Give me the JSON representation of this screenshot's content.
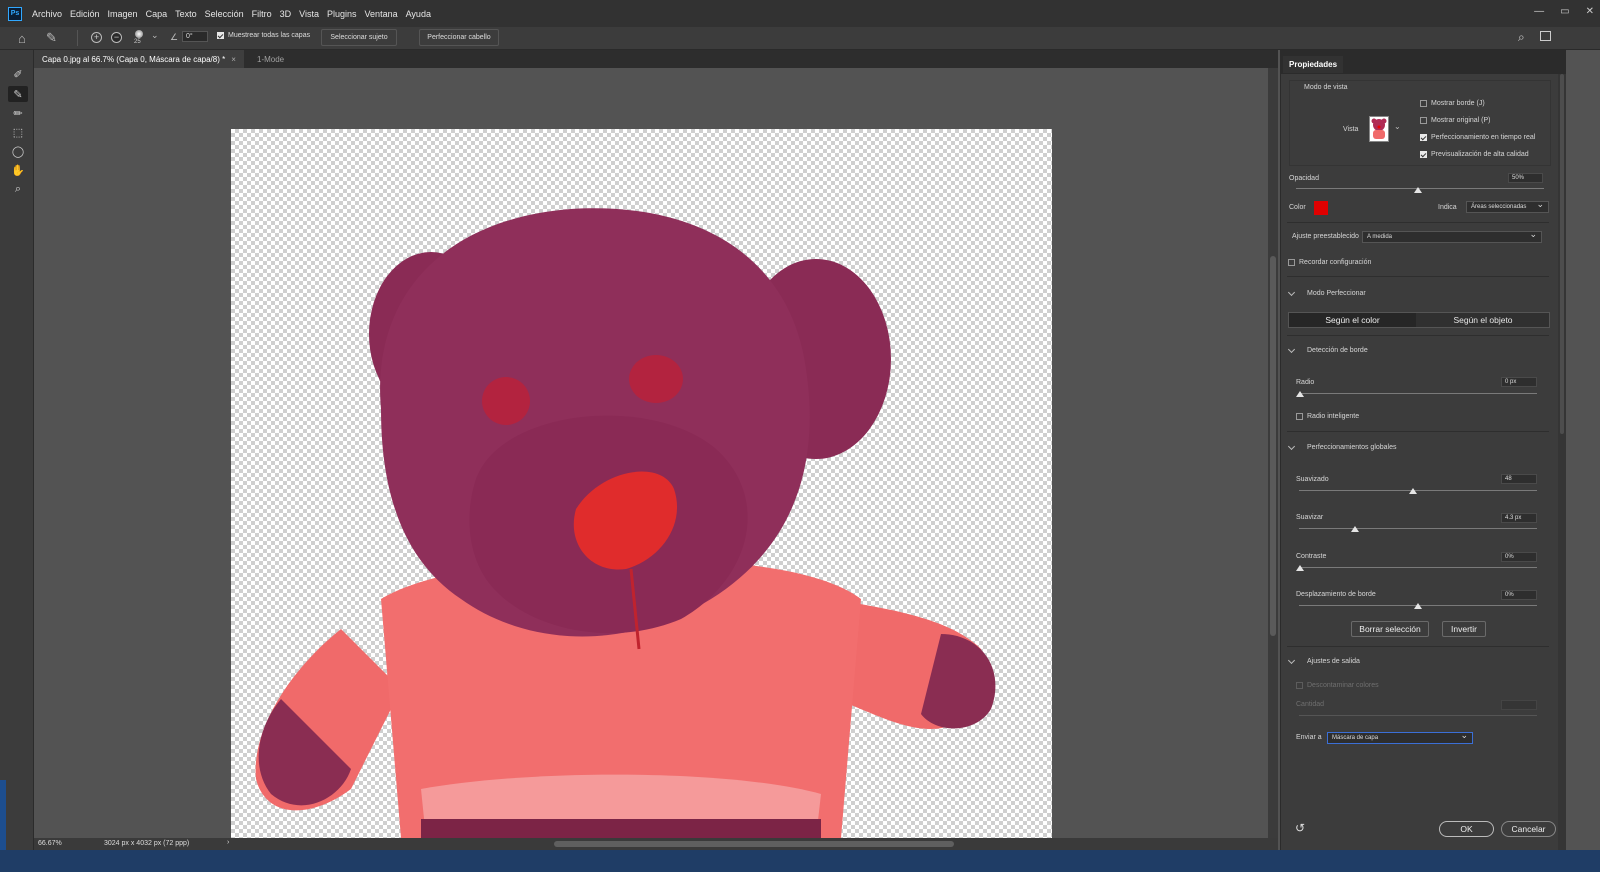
{
  "menu": [
    "Archivo",
    "Edición",
    "Imagen",
    "Capa",
    "Texto",
    "Selección",
    "Filtro",
    "3D",
    "Vista",
    "Plugins",
    "Ventana",
    "Ayuda"
  ],
  "app_logo": "Ps",
  "window_controls": [
    "—",
    "▭",
    "✕"
  ],
  "options_bar": {
    "brush_size": "25",
    "angle": "0°",
    "sample_all_layers": "Muestrear todas las capas",
    "select_subject": "Seleccionar sujeto",
    "refine_hair": "Perfeccionar cabello"
  },
  "tabs": [
    {
      "label": "Capa 0.jpg al 66.7% (Capa 0, Máscara de capa/8) *",
      "close": "×"
    },
    {
      "label": "1-Mode"
    }
  ],
  "status": {
    "zoom": "66.67%",
    "doc_info": "3024 px x 4032 px (72 ppp)",
    "arrow": "›"
  },
  "panel": {
    "title": "Propiedades",
    "view_mode": {
      "title": "Modo de vista",
      "view_label": "Vista",
      "options": [
        {
          "label": "Mostrar borde (J)",
          "checked": false
        },
        {
          "label": "Mostrar original (P)",
          "checked": false
        },
        {
          "label": "Perfeccionamiento en tiempo real",
          "checked": true
        },
        {
          "label": "Previsualización de alta calidad",
          "checked": true
        }
      ]
    },
    "opacity": {
      "label": "Opacidad",
      "value": "50%",
      "level": 0.5
    },
    "color": {
      "label": "Color",
      "value": "#e00000",
      "indicates_label": "Indica",
      "indicates_value": "Áreas seleccionadas"
    },
    "preset": {
      "label": "Ajuste preestablecido",
      "value": "A medida"
    },
    "remember": {
      "label": "Recordar configuración",
      "checked": false
    },
    "refine_mode": {
      "title": "Modo Perfeccionar",
      "by_color": "Según el color",
      "by_object": "Según el objeto",
      "selected": "by_color"
    },
    "edge_detection": {
      "title": "Detección de borde",
      "radius_label": "Radio",
      "radius_value": "0 px",
      "radius_level": 0,
      "smart_radius": "Radio inteligente"
    },
    "global": {
      "title": "Perfeccionamientos globales",
      "sliders": [
        {
          "label": "Suavizado",
          "value": "48",
          "level": 0.48
        },
        {
          "label": "Suavizar",
          "value": "4.3 px",
          "level": 0.23
        },
        {
          "label": "Contraste",
          "value": "0%",
          "level": 0
        },
        {
          "label": "Desplazamiento de borde",
          "value": "0%",
          "level": 0.5
        }
      ],
      "clear_selection": "Borrar selección",
      "invert": "Invertir"
    },
    "output": {
      "title": "Ajustes de salida",
      "decontaminate": "Descontaminar colores",
      "amount": "Cantidad",
      "send_to_label": "Enviar a",
      "send_to_value": "Máscara de capa"
    },
    "ok": "OK",
    "cancel": "Cancelar"
  },
  "colors": {
    "mask_red": "#e00000",
    "arrow_red": "#d81414",
    "accent_blue": "#31a8ff"
  }
}
